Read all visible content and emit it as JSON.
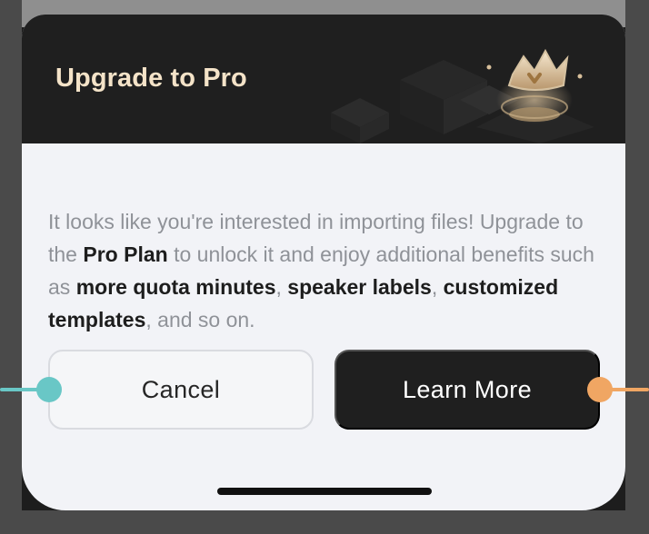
{
  "modal": {
    "title": "Upgrade to Pro",
    "message_parts": [
      {
        "text": "It looks like you're interested in importing files! Upgrade to the ",
        "bold": false
      },
      {
        "text": "Pro Plan",
        "bold": true
      },
      {
        "text": " to unlock it and enjoy additional benefits such as ",
        "bold": false
      },
      {
        "text": "more quota minutes",
        "bold": true
      },
      {
        "text": ", ",
        "bold": false
      },
      {
        "text": "speaker labels",
        "bold": true
      },
      {
        "text": ", ",
        "bold": false
      },
      {
        "text": "customized templates",
        "bold": true
      },
      {
        "text": ", and so on.",
        "bold": false
      }
    ],
    "buttons": {
      "cancel": "Cancel",
      "learn_more": "Learn More"
    }
  },
  "icons": {
    "header": "crown-icon",
    "cancel_connector": "teal-connector-dot",
    "learn_more_connector": "orange-connector-dot"
  },
  "colors": {
    "dark_surface": "#1f1f1f",
    "sheet_background": "#f2f3f7",
    "title_text": "#f4e3c8",
    "muted_text": "#8f9298",
    "emphasis_text": "#1d1d1d",
    "cancel_border": "#d9dbe0",
    "teal_accent": "#69c7c6",
    "orange_accent": "#f0a663",
    "gold_accent": "#d8c09b"
  }
}
